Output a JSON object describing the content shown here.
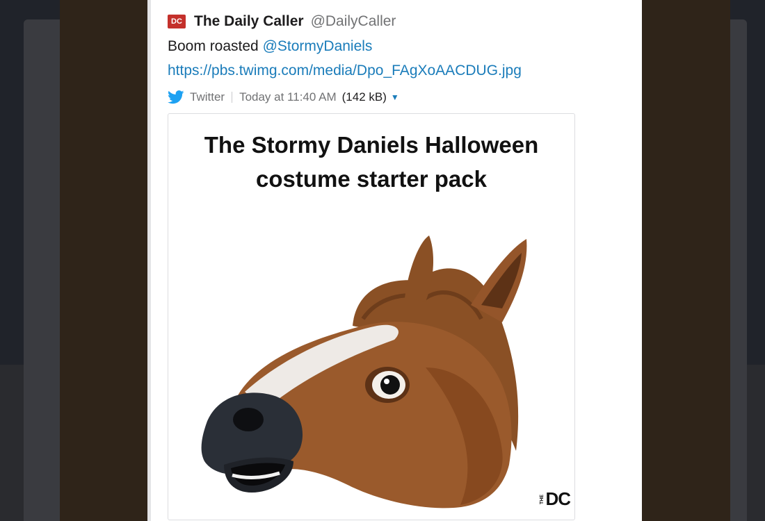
{
  "tweet": {
    "author_name": "The Daily Caller",
    "author_handle": "@DailyCaller",
    "logo_text": "DC",
    "text_prefix": "Boom roasted ",
    "mention": "@StormyDaniels",
    "link": "https://pbs.twimg.com/media/Dpo_FAgXoAACDUG.jpg",
    "source": "Twitter",
    "timestamp": "Today at 11:40 AM",
    "file_size": "(142 kB)",
    "caret_icon": "caret-down-icon",
    "source_icon": "twitter-bird-icon"
  },
  "image": {
    "title_line1": "The Stormy Daniels Halloween",
    "title_line2": "costume starter pack",
    "watermark_small": "THE",
    "watermark_big": "DC",
    "depicted": "horse-mask-icon"
  },
  "colors": {
    "link": "#1a7cba",
    "logo_red": "#c4302b",
    "text": "#1d1c1d",
    "muted": "#717274"
  }
}
